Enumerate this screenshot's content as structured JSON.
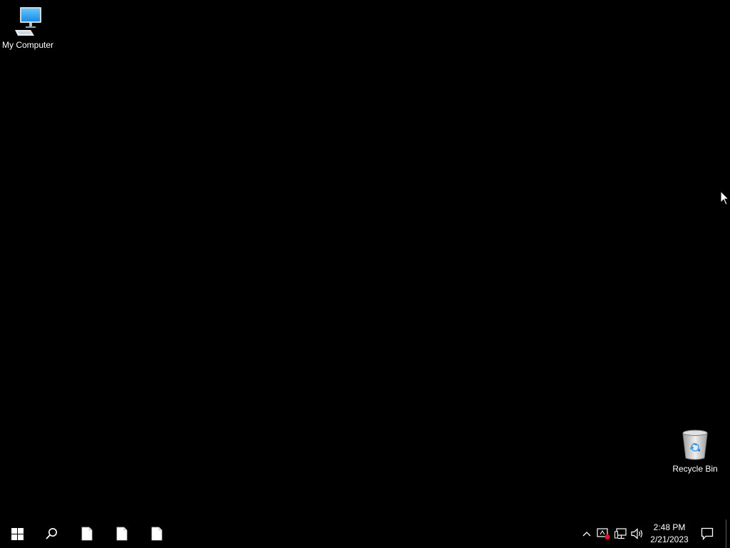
{
  "desktop": {
    "background_color": "#000000",
    "icons": [
      {
        "label": "My Computer",
        "icon": "computer-monitor-icon"
      },
      {
        "label": "Recycle Bin",
        "icon": "recycle-bin-icon"
      }
    ]
  },
  "taskbar": {
    "background_color": "#000000",
    "start_icon": "windows-logo-icon",
    "search_icon": "search-icon",
    "pinned_items": [
      {
        "icon": "blank-document-icon"
      },
      {
        "icon": "blank-document-icon"
      },
      {
        "icon": "blank-document-icon"
      }
    ],
    "tray": {
      "icons": [
        "chevron-up-icon",
        "device-warning-icon",
        "network-icon",
        "volume-icon"
      ],
      "time": "2:48 PM",
      "date": "2/21/2023",
      "action_center_icon": "notification-icon"
    }
  }
}
